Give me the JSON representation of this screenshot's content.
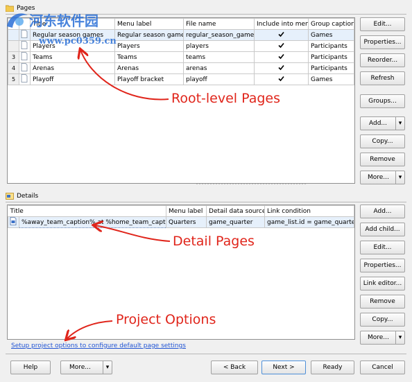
{
  "pages_group": {
    "title": "Pages",
    "columns": [
      "Title",
      "Menu label",
      "File name",
      "Include into menu",
      "Group caption"
    ],
    "rows": [
      {
        "num": "",
        "title": "Regular season games",
        "menu": "Regular season games",
        "file": "regular_season_games",
        "include": true,
        "group": "Games"
      },
      {
        "num": "",
        "title": "Players",
        "menu": "Players",
        "file": "players",
        "include": true,
        "group": "Participants"
      },
      {
        "num": "3",
        "title": "Teams",
        "menu": "Teams",
        "file": "teams",
        "include": true,
        "group": "Participants"
      },
      {
        "num": "4",
        "title": "Arenas",
        "menu": "Arenas",
        "file": "arenas",
        "include": true,
        "group": "Participants"
      },
      {
        "num": "5",
        "title": "Playoff",
        "menu": "Playoff bracket",
        "file": "playoff",
        "include": true,
        "group": "Games"
      }
    ],
    "buttons": {
      "edit": "Edit...",
      "properties": "Properties...",
      "reorder": "Reorder...",
      "refresh": "Refresh",
      "groups": "Groups...",
      "add": "Add...",
      "copy": "Copy...",
      "remove": "Remove",
      "more": "More..."
    }
  },
  "details_group": {
    "title": "Details",
    "columns": [
      "Title",
      "Menu label",
      "Detail data source",
      "Link condition"
    ],
    "rows": [
      {
        "title": "%away_team_caption% at %home_team_caption",
        "menu": "Quarters",
        "source": "game_quarter",
        "link": "game_list.id = game_quarter.g"
      }
    ],
    "buttons": {
      "add": "Add...",
      "add_child": "Add child...",
      "edit": "Edit...",
      "properties": "Properties...",
      "link_editor": "Link editor...",
      "remove": "Remove",
      "copy": "Copy...",
      "more": "More..."
    }
  },
  "project_options_link": "Setup project options to configure default page settings",
  "annotations": {
    "root": "Root-level Pages",
    "detail": "Detail Pages",
    "project": "Project Options"
  },
  "watermark": {
    "brand": "河东软件园",
    "url": "www.pc0359.cn"
  },
  "footer": {
    "help": "Help",
    "more": "More...",
    "back": "< Back",
    "next": "Next >",
    "ready": "Ready",
    "cancel": "Cancel"
  },
  "colors": {
    "annotation": "#e0251b",
    "link": "#1f53d4",
    "watermark": "#2a6fd6"
  }
}
